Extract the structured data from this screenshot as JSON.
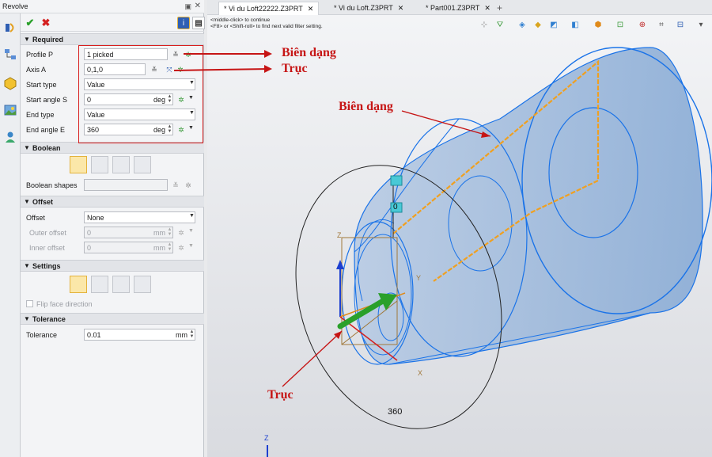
{
  "panel": {
    "title": "Revolve",
    "info_label": "i",
    "sections": {
      "required": "Required",
      "boolean": "Boolean",
      "offset": "Offset",
      "settings": "Settings",
      "tolerance": "Tolerance"
    },
    "required": {
      "profile_label": "Profile P",
      "profile_value": "1 picked",
      "axis_label": "Axis A",
      "axis_value": "0,1,0",
      "start_type_label": "Start type",
      "start_type_value": "Value",
      "start_angle_label": "Start angle S",
      "start_angle_value": "0",
      "start_angle_unit": "deg",
      "end_type_label": "End type",
      "end_type_value": "Value",
      "end_angle_label": "End angle E",
      "end_angle_value": "360",
      "end_angle_unit": "deg"
    },
    "boolean": {
      "shapes_label": "Boolean shapes"
    },
    "offset": {
      "offset_label": "Offset",
      "offset_value": "None",
      "outer_label": "Outer offset",
      "outer_value": "0",
      "outer_unit": "mm",
      "inner_label": "Inner offset",
      "inner_value": "0",
      "inner_unit": "mm"
    },
    "settings": {
      "flip_label": "Flip face direction"
    },
    "tolerance": {
      "label": "Tolerance",
      "value": "0.01",
      "unit": "mm"
    }
  },
  "tabs": [
    {
      "label": "* Vi du Loft22222.Z3PRT"
    },
    {
      "label": "* Vi du Loft.Z3PRT"
    },
    {
      "label": "* Part001.Z3PRT"
    }
  ],
  "tab_close": "✕",
  "add_tab": "+",
  "hints": {
    "line1": "<middle-click> to continue",
    "line2": "<F8> or <Shift-roll> to find next valid filter setting."
  },
  "annotations": {
    "panel_profile": "Biên dạng",
    "panel_axis": "Trục",
    "view_profile": "Biên dạng",
    "view_axis": "Trục"
  },
  "viewport_labels": {
    "angle_value": "360",
    "handle_value": "0",
    "axis_z": "Z",
    "axis_x": "X",
    "axis_y": "Y",
    "triad_z": "Z"
  },
  "colors": {
    "accent_red": "#c61515",
    "solid_blue": "#8fb0d6",
    "edge_blue": "#1a73e8",
    "profile_orange": "#f0a020"
  }
}
